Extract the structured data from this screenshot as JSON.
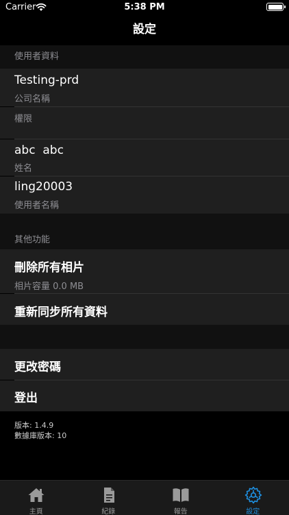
{
  "status_bar": {
    "carrier": "Carrier",
    "time": "5:38 PM"
  },
  "nav": {
    "title": "設定"
  },
  "sections": {
    "user_info": {
      "header": "使用者資料",
      "company": {
        "value": "Testing-prd",
        "label": "公司名稱"
      },
      "permission": {
        "label": "權限"
      },
      "name": {
        "value": "abc  abc",
        "label": "姓名"
      },
      "username": {
        "value": "ling20003",
        "label": "使用者名稱"
      }
    },
    "other": {
      "header": "其他功能",
      "delete_photos": {
        "label": "刪除所有相片",
        "sub": "相片容量 0.0 MB"
      },
      "resync": {
        "label": "重新同步所有資料"
      }
    },
    "account": {
      "change_password": "更改密碼",
      "logout": "登出"
    }
  },
  "version": {
    "app": "版本: 1.4.9",
    "db": "數據庫版本: 10"
  },
  "tabs": [
    {
      "label": "主頁",
      "icon": "home-icon"
    },
    {
      "label": "紀錄",
      "icon": "document-icon"
    },
    {
      "label": "報告",
      "icon": "book-icon"
    },
    {
      "label": "設定",
      "icon": "gear-icon",
      "active": true
    }
  ],
  "colors": {
    "accent": "#1e8fe0",
    "background": "#000000",
    "cell": "#1f1f1f",
    "secondary_text": "#8e8e93"
  }
}
